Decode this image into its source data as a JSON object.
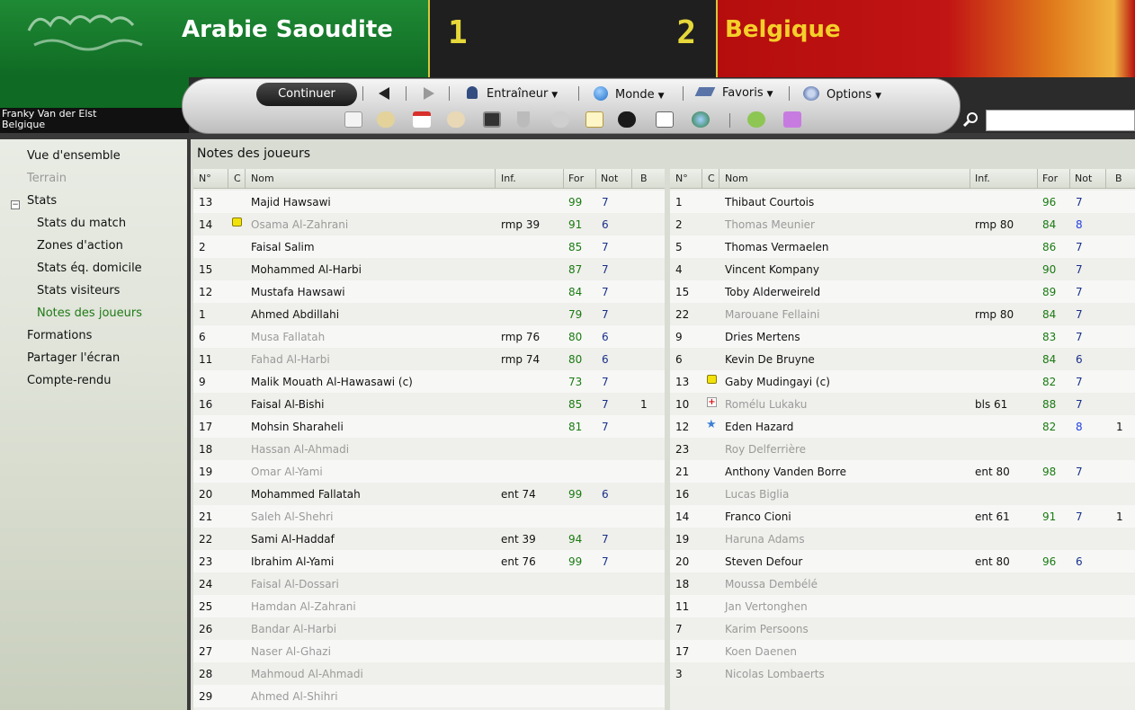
{
  "header": {
    "home_team": "Arabie Saoudite",
    "away_team": "Belgique",
    "home_score": "1",
    "away_score": "2",
    "manager_name": "Franky Van der Elst",
    "manager_team": "Belgique",
    "colors": {
      "home_green": "#1f8a35",
      "away_red": "#c11414",
      "score_yellow": "#e6d83a",
      "away_name_yellow": "#f4cf2a"
    }
  },
  "toolbar": {
    "continue_label": "Continuer",
    "menus": [
      {
        "label": "Entraîneur",
        "icon": "manager-icon"
      },
      {
        "label": "Monde",
        "icon": "globe-icon"
      },
      {
        "label": "Favoris",
        "icon": "bookmark-icon"
      },
      {
        "label": "Options",
        "icon": "gears-icon"
      }
    ],
    "icons": [
      "home-icon",
      "inbox-icon",
      "calendar-icon",
      "squad-icon",
      "tactics-icon",
      "trophy-icon",
      "scout-icon",
      "notebook-icon",
      "binoculars-icon",
      "news-icon",
      "world-icon",
      "help-icon",
      "question-icon"
    ]
  },
  "sidebar": {
    "items": [
      {
        "label": "Vue d'ensemble"
      },
      {
        "label": "Terrain"
      },
      {
        "label": "Stats"
      },
      {
        "label": "Stats du match"
      },
      {
        "label": "Zones d'action"
      },
      {
        "label": "Stats éq. domicile"
      },
      {
        "label": "Stats visiteurs"
      },
      {
        "label": "Notes des joueurs"
      },
      {
        "label": "Formations"
      },
      {
        "label": "Partager l'écran"
      },
      {
        "label": "Compte-rendu"
      }
    ],
    "expander": "−"
  },
  "panel": {
    "title": "Notes des joueurs",
    "columns": {
      "no": "N°",
      "c": "C",
      "name": "Nom",
      "inf": "Inf.",
      "for": "For",
      "not": "Not",
      "b": "B"
    },
    "home_rows": [
      {
        "no": "13",
        "name": "Majid Hawsawi",
        "inf": "",
        "for": "99",
        "not": "7",
        "b": "",
        "card": ""
      },
      {
        "no": "14",
        "name": "Osama Al-Zahrani",
        "inf": "rmp 39",
        "for": "91",
        "not": "6",
        "b": "",
        "card": "yellow"
      },
      {
        "no": "2",
        "name": "Faisal Salim",
        "inf": "",
        "for": "85",
        "not": "7",
        "b": "",
        "card": ""
      },
      {
        "no": "15",
        "name": "Mohammed Al-Harbi",
        "inf": "",
        "for": "87",
        "not": "7",
        "b": "",
        "card": ""
      },
      {
        "no": "12",
        "name": "Mustafa Hawsawi",
        "inf": "",
        "for": "84",
        "not": "7",
        "b": "",
        "card": ""
      },
      {
        "no": "1",
        "name": "Ahmed Abdillahi",
        "inf": "",
        "for": "79",
        "not": "7",
        "b": "",
        "card": ""
      },
      {
        "no": "6",
        "name": "Musa Fallatah",
        "inf": "rmp 76",
        "for": "80",
        "not": "6",
        "b": "",
        "card": ""
      },
      {
        "no": "11",
        "name": "Fahad Al-Harbi",
        "inf": "rmp 74",
        "for": "80",
        "not": "6",
        "b": "",
        "card": ""
      },
      {
        "no": "9",
        "name": "Malik Mouath Al-Hawasawi (c)",
        "inf": "",
        "for": "73",
        "not": "7",
        "b": "",
        "card": ""
      },
      {
        "no": "16",
        "name": "Faisal Al-Bishi",
        "inf": "",
        "for": "85",
        "not": "7",
        "b": "1",
        "card": ""
      },
      {
        "no": "17",
        "name": "Mohsin Sharaheli",
        "inf": "",
        "for": "81",
        "not": "7",
        "b": "",
        "card": ""
      },
      {
        "no": "18",
        "name": "Hassan Al-Ahmadi",
        "inf": "",
        "for": "",
        "not": "",
        "b": "",
        "card": ""
      },
      {
        "no": "19",
        "name": "Omar Al-Yami",
        "inf": "",
        "for": "",
        "not": "",
        "b": "",
        "card": ""
      },
      {
        "no": "20",
        "name": "Mohammed Fallatah",
        "inf": "ent 74",
        "for": "99",
        "not": "6",
        "b": "",
        "card": ""
      },
      {
        "no": "21",
        "name": "Saleh Al-Shehri",
        "inf": "",
        "for": "",
        "not": "",
        "b": "",
        "card": ""
      },
      {
        "no": "22",
        "name": "Sami Al-Haddaf",
        "inf": "ent 39",
        "for": "94",
        "not": "7",
        "b": "",
        "card": ""
      },
      {
        "no": "23",
        "name": "Ibrahim Al-Yami",
        "inf": "ent 76",
        "for": "99",
        "not": "7",
        "b": "",
        "card": ""
      },
      {
        "no": "24",
        "name": "Faisal Al-Dossari",
        "inf": "",
        "for": "",
        "not": "",
        "b": "",
        "card": ""
      },
      {
        "no": "25",
        "name": "Hamdan Al-Zahrani",
        "inf": "",
        "for": "",
        "not": "",
        "b": "",
        "card": ""
      },
      {
        "no": "26",
        "name": "Bandar Al-Harbi",
        "inf": "",
        "for": "",
        "not": "",
        "b": "",
        "card": ""
      },
      {
        "no": "27",
        "name": "Naser Al-Ghazi",
        "inf": "",
        "for": "",
        "not": "",
        "b": "",
        "card": ""
      },
      {
        "no": "28",
        "name": "Mahmoud Al-Ahmadi",
        "inf": "",
        "for": "",
        "not": "",
        "b": "",
        "card": ""
      },
      {
        "no": "29",
        "name": "Ahmed Al-Shihri",
        "inf": "",
        "for": "",
        "not": "",
        "b": "",
        "card": ""
      }
    ],
    "away_rows": [
      {
        "no": "1",
        "name": "Thibaut Courtois",
        "inf": "",
        "for": "96",
        "not": "7",
        "b": "",
        "card": ""
      },
      {
        "no": "2",
        "name": "Thomas Meunier",
        "inf": "rmp 80",
        "for": "84",
        "not": "8",
        "b": "",
        "card": ""
      },
      {
        "no": "5",
        "name": "Thomas Vermaelen",
        "inf": "",
        "for": "86",
        "not": "7",
        "b": "",
        "card": ""
      },
      {
        "no": "4",
        "name": "Vincent Kompany",
        "inf": "",
        "for": "90",
        "not": "7",
        "b": "",
        "card": ""
      },
      {
        "no": "15",
        "name": "Toby Alderweireld",
        "inf": "",
        "for": "89",
        "not": "7",
        "b": "",
        "card": ""
      },
      {
        "no": "22",
        "name": "Marouane Fellaini",
        "inf": "rmp 80",
        "for": "84",
        "not": "7",
        "b": "",
        "card": ""
      },
      {
        "no": "9",
        "name": "Dries Mertens",
        "inf": "",
        "for": "83",
        "not": "7",
        "b": "",
        "card": ""
      },
      {
        "no": "6",
        "name": "Kevin De Bruyne",
        "inf": "",
        "for": "84",
        "not": "6",
        "b": "",
        "card": ""
      },
      {
        "no": "13",
        "name": "Gaby Mudingayi (c)",
        "inf": "",
        "for": "82",
        "not": "7",
        "b": "",
        "card": "yellow"
      },
      {
        "no": "10",
        "name": "Romélu Lukaku",
        "inf": "bls 61",
        "for": "88",
        "not": "7",
        "b": "",
        "card": "injury"
      },
      {
        "no": "12",
        "name": "Eden Hazard",
        "inf": "",
        "for": "82",
        "not": "8",
        "b": "1",
        "card": "star"
      },
      {
        "no": "23",
        "name": "Roy Delferrière",
        "inf": "",
        "for": "",
        "not": "",
        "b": "",
        "card": ""
      },
      {
        "no": "21",
        "name": "Anthony Vanden Borre",
        "inf": "ent 80",
        "for": "98",
        "not": "7",
        "b": "",
        "card": ""
      },
      {
        "no": "16",
        "name": "Lucas Biglia",
        "inf": "",
        "for": "",
        "not": "",
        "b": "",
        "card": ""
      },
      {
        "no": "14",
        "name": "Franco Cioni",
        "inf": "ent 61",
        "for": "91",
        "not": "7",
        "b": "1",
        "card": ""
      },
      {
        "no": "19",
        "name": "Haruna Adams",
        "inf": "",
        "for": "",
        "not": "",
        "b": "",
        "card": ""
      },
      {
        "no": "20",
        "name": "Steven Defour",
        "inf": "ent 80",
        "for": "96",
        "not": "6",
        "b": "",
        "card": ""
      },
      {
        "no": "18",
        "name": "Moussa Dembélé",
        "inf": "",
        "for": "",
        "not": "",
        "b": "",
        "card": ""
      },
      {
        "no": "11",
        "name": "Jan Vertonghen",
        "inf": "",
        "for": "",
        "not": "",
        "b": "",
        "card": ""
      },
      {
        "no": "7",
        "name": "Karim Persoons",
        "inf": "",
        "for": "",
        "not": "",
        "b": "",
        "card": ""
      },
      {
        "no": "17",
        "name": "Koen Daenen",
        "inf": "",
        "for": "",
        "not": "",
        "b": "",
        "card": ""
      },
      {
        "no": "3",
        "name": "Nicolas Lombaerts",
        "inf": "",
        "for": "",
        "not": "",
        "b": "",
        "card": ""
      }
    ]
  }
}
